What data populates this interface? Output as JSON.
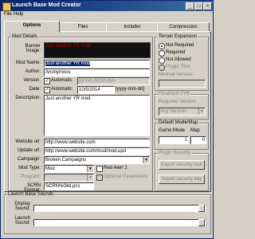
{
  "window": {
    "title": "Launch Base Mod Creator",
    "min": "_",
    "max": "□",
    "close": "×"
  },
  "menu": {
    "file": "File",
    "help": "Help"
  },
  "tabs": [
    "Options",
    "Files",
    "Installer",
    "Compression"
  ],
  "mod_details": {
    "group_label": "Mod Details",
    "banner_label": "Banner Image:",
    "banner_text": "Just another YR mod",
    "mod_name_label": "Mod Name:",
    "mod_name_value": "Just another YR mod",
    "author_label": "Author:",
    "author_value": "Anonymous",
    "version_label": "Version:",
    "version_auto": "Automatic",
    "version_placeholder": "yy.mm.dd.hh.mm",
    "date_label": "Date:",
    "date_auto": "Automatic",
    "date_value": "10/5/2014",
    "date_format": "[yyyy-mm-dd]",
    "description_label": "Description:",
    "description_value": "Just another YR mod.",
    "website_label": "Website url:",
    "website_value": "http://www.website.com",
    "update_label": "Update url:",
    "update_value": "http://www.website.com/mod/mod.upd",
    "campaign_label": "Campaign:",
    "campaign_value": "Broken Campaigns",
    "mod_type_label": "Mod Type:",
    "mod_type_value": "Mod",
    "red_alert_label": "Red Alert 2",
    "program_label": "Program:",
    "optional_params_label": "Optional Parameters",
    "scrn_format_label": "SCRN Format:",
    "scrn_format_value": "SCRN%04d.pcx"
  },
  "terrain": {
    "group_label": "Terrain Expansion",
    "options": [
      "Not Required",
      "Required",
      "Not Allowed",
      "Plugin Tiles"
    ],
    "selected": 0,
    "minimal_version_label": "Minimal Version:"
  },
  "finalalert": {
    "group_label": "FinalAlert 2YR",
    "required_version_label": "Required Version:",
    "required_version_value": "Any Version"
  },
  "default_mode": {
    "group_label": "Default Mode/Map",
    "game_mode_label": "Game Mode",
    "map_label": "Map",
    "game_mode_value": "1",
    "map_value": "0"
  },
  "plugin_security": {
    "group_label": "Plugin Security",
    "export_btn": "Export security lock",
    "import_btn": "Import security key"
  },
  "sounds": {
    "group_label": "Launch Base Sounds",
    "display_label": "Display Sound:",
    "launch_label": "Launch Sound:"
  }
}
